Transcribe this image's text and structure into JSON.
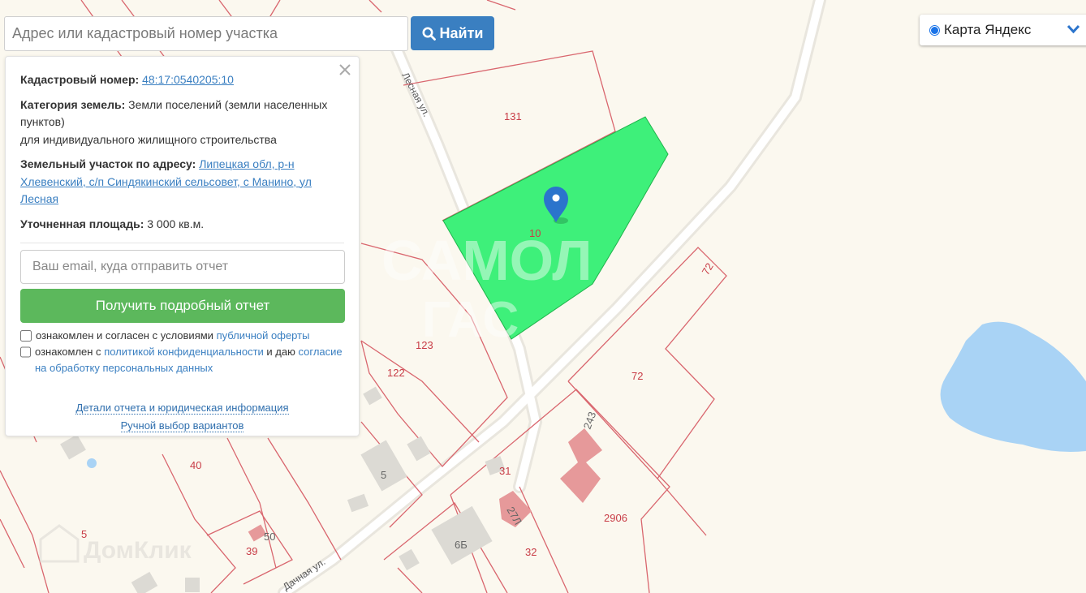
{
  "search": {
    "placeholder": "Адрес или кадастровый номер участка",
    "button_label": "Найти"
  },
  "map_type": {
    "selected": "Карта Яндекс",
    "icon": "chevron-down-icon"
  },
  "panel": {
    "cadastral": {
      "label": "Кадастровый номер:",
      "value": "48:17:0540205:10"
    },
    "category": {
      "label": "Категория земель:",
      "value_part1": "Земли поселений (земли населенных пунктов)",
      "value_part2": "для индивидуального жилищного строительства"
    },
    "address": {
      "label": "Земельный участок по адресу:",
      "value": "Липецкая обл, р-н Хлевенский, с/п Синдякинский сельсовет, с Манино, ул Лесная"
    },
    "area": {
      "label": "Уточненная площадь:",
      "value": "3 000 кв.м."
    },
    "email_placeholder": "Ваш email, куда отправить отчет",
    "report_button": "Получить подробный отчет",
    "consent1": {
      "text": "ознакомлен и согласен с условиями",
      "link": "публичной оферты"
    },
    "consent2": {
      "text_before": "ознакомлен с",
      "link1": "политикой конфиденциальности",
      "text_mid": "и даю",
      "link2": "согласие на обработку персональных данных"
    },
    "details_link": "Детали отчета и юридическая информация",
    "manual_link": "Ручной выбор вариантов"
  },
  "map": {
    "parcel_labels": [
      "131",
      "10",
      "72",
      "72",
      "123",
      "122",
      "40",
      "5",
      "39",
      "31",
      "32",
      "2906"
    ],
    "building_labels": [
      "5",
      "6Б",
      "50",
      "243",
      "27Л"
    ],
    "street_labels": [
      "Лесная ул.",
      "Дачная ул."
    ],
    "watermark_domclick": "ДомКлик",
    "colors": {
      "parcel_border": "#d9666e",
      "selected_parcel": "#3ef07a",
      "water": "#a9d3f5",
      "marker": "#2b74cc",
      "building": "#e6999a"
    }
  }
}
